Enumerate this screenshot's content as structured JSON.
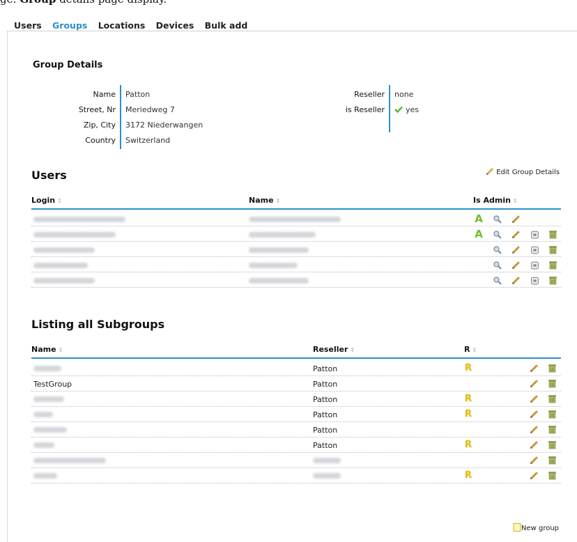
{
  "caption": {
    "prefix": "ge: ",
    "bold": "Group",
    "suffix": " details page display."
  },
  "nav": {
    "tabs": [
      "Users",
      "Groups",
      "Locations",
      "Devices",
      "Bulk add"
    ],
    "active": "Groups"
  },
  "group_details": {
    "title": "Group Details",
    "left": [
      {
        "label": "Name",
        "value": "Patton"
      },
      {
        "label": "Street, Nr",
        "value": "Meriedweg 7"
      },
      {
        "label": "Zip, City",
        "value": "3172 Niederwangen"
      },
      {
        "label": "Country",
        "value": "Switzerland"
      }
    ],
    "right": [
      {
        "label": "Reseller",
        "value": "none"
      },
      {
        "label": "is Reseller",
        "value": "yes"
      }
    ]
  },
  "users": {
    "title": "Users",
    "edit_link": "Edit Group Details",
    "columns": [
      "Login",
      "Name",
      "Is Admin"
    ],
    "rows": [
      {
        "admin": true,
        "edit_only": true
      },
      {
        "admin": true,
        "edit_only": false
      },
      {
        "admin": false,
        "edit_only": false
      },
      {
        "admin": false,
        "edit_only": false
      },
      {
        "admin": false,
        "edit_only": false
      }
    ]
  },
  "subgroups": {
    "title": "Listing all Subgroups",
    "columns": [
      "Name",
      "Reseller",
      "R"
    ],
    "rows": [
      {
        "name": "",
        "reseller": "Patton",
        "r": true
      },
      {
        "name": "TestGroup",
        "reseller": "Patton",
        "r": false
      },
      {
        "name": "",
        "reseller": "Patton",
        "r": true
      },
      {
        "name": "",
        "reseller": "Patton",
        "r": true
      },
      {
        "name": "",
        "reseller": "Patton",
        "r": false
      },
      {
        "name": "",
        "reseller": "Patton",
        "r": true
      },
      {
        "name": "",
        "reseller": "",
        "r": false
      },
      {
        "name": "",
        "reseller": "",
        "r": true
      }
    ],
    "new_link": "New group"
  },
  "colors": {
    "accent": "#2b8fc6",
    "admin": "#6fbf2a",
    "reseller_badge": "#e6c01a"
  }
}
